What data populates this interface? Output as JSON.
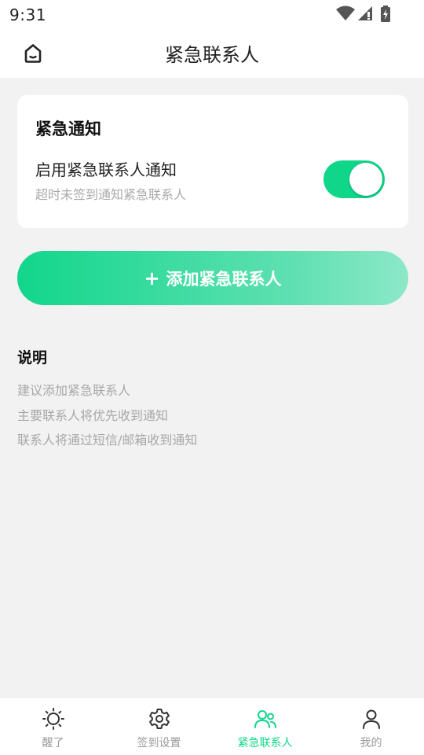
{
  "status_bar": {
    "time": "9:31"
  },
  "header": {
    "title": "紧急联系人",
    "home_icon": "home-icon"
  },
  "notify_card": {
    "title": "紧急通知",
    "setting_label": "启用紧急联系人通知",
    "setting_desc": "超时未签到通知紧急联系人",
    "toggle_on": true,
    "accent_color": "#10d68a"
  },
  "add_button": {
    "plus": "+",
    "label": "添加紧急联系人"
  },
  "notes": {
    "title": "说明",
    "lines": [
      "建议添加紧急联系人",
      "主要联系人将优先收到通知",
      "联系人将通过短信/邮箱收到通知"
    ]
  },
  "tabs": [
    {
      "label": "醒了",
      "icon": "sun-icon",
      "active": false
    },
    {
      "label": "签到设置",
      "icon": "gear-icon",
      "active": false
    },
    {
      "label": "紧急联系人",
      "icon": "contacts-icon",
      "active": true
    },
    {
      "label": "我的",
      "icon": "person-icon",
      "active": false
    }
  ]
}
